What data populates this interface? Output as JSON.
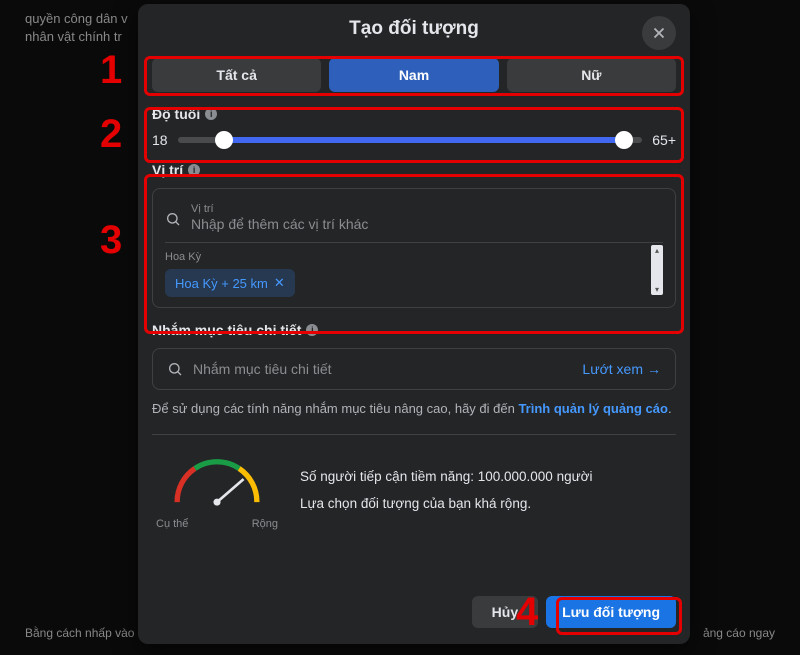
{
  "bg": {
    "top": "quyền công dân v\nnhân vật chính tr",
    "bottom_left": "Bằng cách nhấp vào Qu",
    "bottom_right": "ảng cáo ngay"
  },
  "modal": {
    "title": "Tạo đối tượng"
  },
  "gender": {
    "all": "Tất cả",
    "male": "Nam",
    "female": "Nữ"
  },
  "age": {
    "label": "Độ tuổi",
    "min": "18",
    "max": "65+"
  },
  "location": {
    "label": "Vị trí",
    "inner_label": "Vị trí",
    "placeholder": "Nhập để thêm các vị trí khác",
    "group_label": "Hoa Kỳ",
    "chip": "Hoa Kỳ  + 25 km"
  },
  "targeting": {
    "label": "Nhắm mục tiêu chi tiết",
    "placeholder": "Nhắm mục tiêu chi tiết",
    "browse": "Lướt xem",
    "hint_pre": "Để sử dụng các tính năng nhắm mục tiêu nâng cao, hãy đi đến ",
    "hint_link": "Trình quản lý quảng cáo",
    "hint_post": "."
  },
  "reach": {
    "gauge_left": "Cụ thể",
    "gauge_right": "Rộng",
    "line1": "Số người tiếp cận tiềm năng: 100.000.000 người",
    "line2": "Lựa chọn đối tượng của bạn khá rộng."
  },
  "footer": {
    "cancel": "Hủy",
    "save": "Lưu đối tượng"
  },
  "annotations": {
    "n1": "1",
    "n2": "2",
    "n3": "3",
    "n4": "4"
  }
}
